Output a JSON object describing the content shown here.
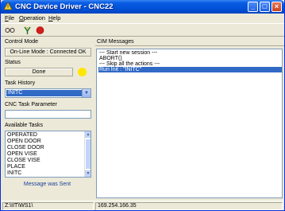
{
  "window": {
    "title": "CNC Device Driver - CNC22"
  },
  "menu": {
    "file": "File",
    "operation": "Operation",
    "help": "Help"
  },
  "toolbar": {
    "items": [
      "connect-icon",
      "antenna-icon",
      "stop-icon"
    ]
  },
  "control_mode": {
    "label": "Control Mode",
    "value": "On-Line Mode : Connected OK"
  },
  "status": {
    "label": "Status",
    "value": "Done",
    "indicator_color": "#ffe600"
  },
  "task_history": {
    "label": "Task History",
    "selected": "INITC"
  },
  "task_parameter": {
    "label": "CNC Task Parameter",
    "value": ""
  },
  "available_tasks": {
    "label": "Available Tasks",
    "items": [
      "OPERATED",
      "OPEN DOOR",
      "CLOSE DOOR",
      "OPEN VISE",
      "CLOSE VISE",
      "PLACE",
      "INITC"
    ]
  },
  "message_sent": "Message was Sent",
  "cim_messages": {
    "label": "CIM Messages",
    "lines": [
      "--- Start new session ---",
      "ABORT()",
      "--- Skip all the actions ---",
      "Run Init : \"INITC\""
    ],
    "selected_index": 3,
    "selection_color": "#316ac5"
  },
  "statusbar": {
    "path": "Z:\\IIT\\WS1\\",
    "ip": "169.254.166.35"
  }
}
